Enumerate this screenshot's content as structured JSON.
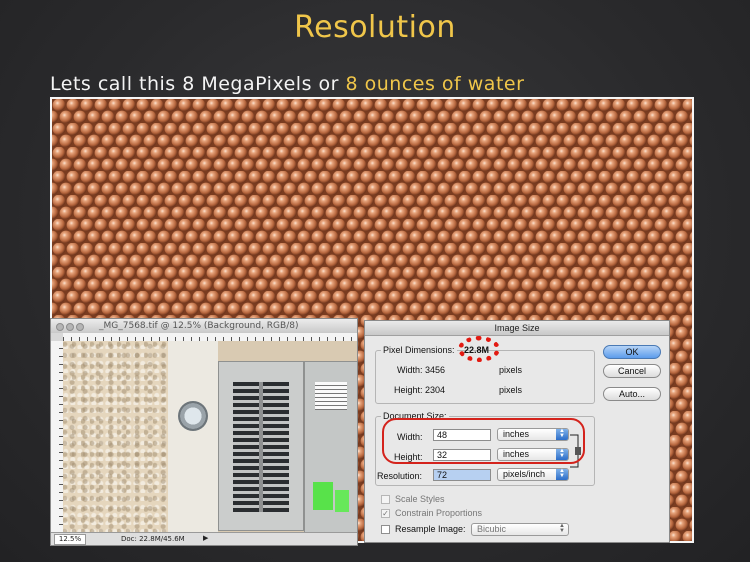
{
  "slide": {
    "title": "Resolution",
    "subtitle_prefix": "Lets call this 8 MegaPixels or ",
    "subtitle_highlight": "8 ounces of water"
  },
  "colors": {
    "title": "#f0c64a",
    "highlight": "#f0c64a",
    "copper": "#c77d56",
    "annotation_red": "#d4231c"
  },
  "doc_window": {
    "title": "_MG_7568.tif @ 12.5% (Background, RGB/8)",
    "zoom": "12.5%",
    "doc_info": "Doc: 22.8M/45.6M",
    "arrow": "▶"
  },
  "dialog": {
    "title": "Image Size",
    "pixel_dimensions_label": "Pixel Dimensions:",
    "pixel_dimensions_value": "22.8M",
    "px_width_label": "Width:",
    "px_width_value": "3456",
    "px_width_unit": "pixels",
    "px_height_label": "Height:",
    "px_height_value": "2304",
    "px_height_unit": "pixels",
    "document_size_label": "Document Size:",
    "doc_width_label": "Width:",
    "doc_width_value": "48",
    "doc_width_unit": "inches",
    "doc_height_label": "Height:",
    "doc_height_value": "32",
    "doc_height_unit": "inches",
    "resolution_label": "Resolution:",
    "resolution_value": "72",
    "resolution_unit": "pixels/inch",
    "scale_styles": "Scale Styles",
    "constrain_proportions": "Constrain Proportions",
    "resample_image": "Resample Image:",
    "resample_method": "Bicubic",
    "ok": "OK",
    "cancel": "Cancel",
    "auto": "Auto...",
    "constrain_checked": "✓"
  }
}
